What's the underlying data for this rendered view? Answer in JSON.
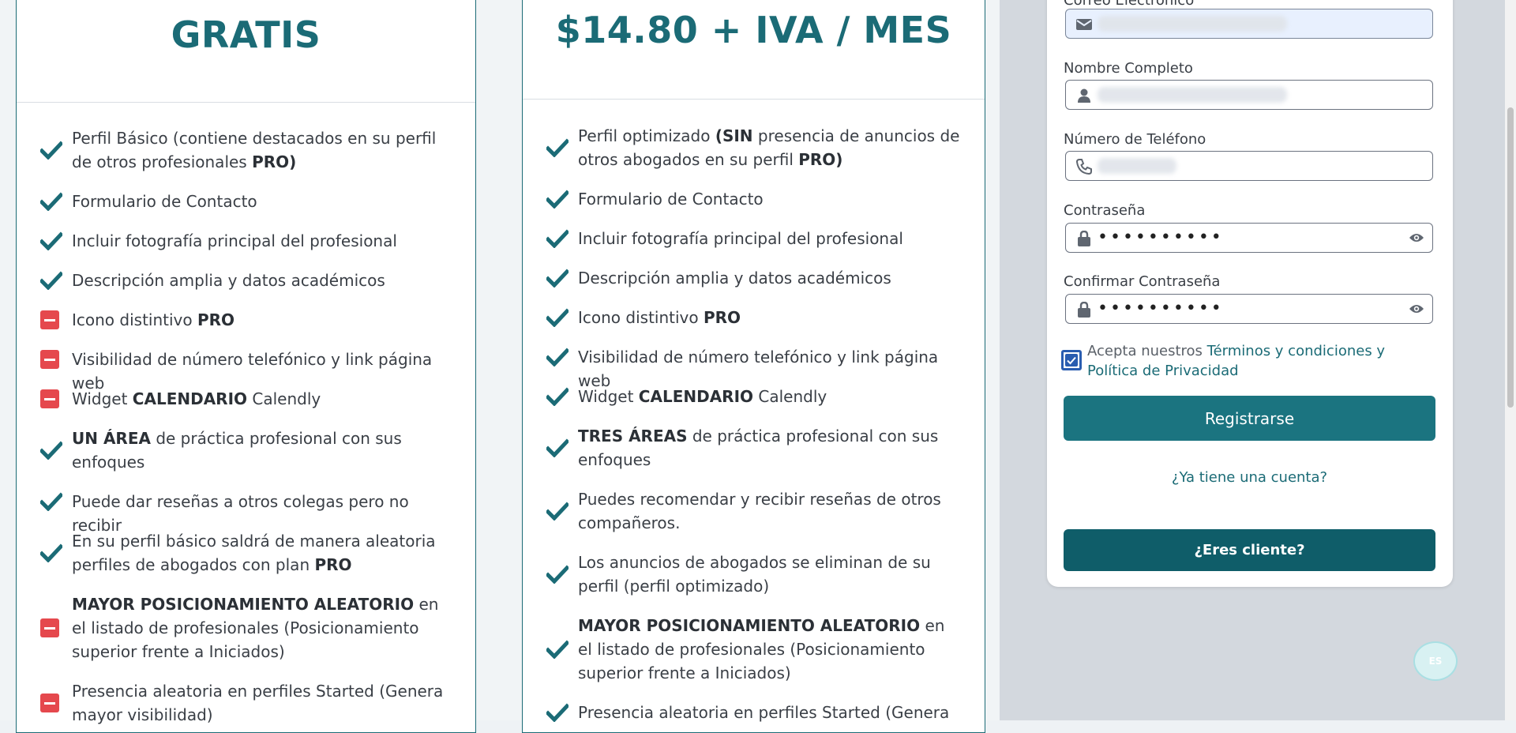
{
  "plans": [
    {
      "price": "GRATIS",
      "features": [
        {
          "icon": "check",
          "parts": [
            {
              "t": "Perfil Básico (contiene destacados en su perfil de otros profesionales "
            },
            {
              "t": "PRO)",
              "b": true
            }
          ]
        },
        {
          "icon": "check",
          "parts": [
            {
              "t": "Formulario de Contacto"
            }
          ]
        },
        {
          "icon": "check",
          "parts": [
            {
              "t": "Incluir fotografía principal del profesional"
            }
          ]
        },
        {
          "icon": "check",
          "parts": [
            {
              "t": "Descripción amplia y datos académicos"
            }
          ]
        },
        {
          "icon": "minus",
          "parts": [
            {
              "t": "Icono distintivo "
            },
            {
              "t": "PRO",
              "b": true
            }
          ]
        },
        {
          "icon": "minus",
          "parts": [
            {
              "t": "Visibilidad de número telefónico y link página web"
            }
          ]
        },
        {
          "icon": "minus",
          "parts": [
            {
              "t": "Widget "
            },
            {
              "t": "CALENDARIO",
              "b": true
            },
            {
              "t": " Calendly"
            }
          ]
        },
        {
          "icon": "check",
          "parts": [
            {
              "t": "UN ÁREA",
              "b": true
            },
            {
              "t": " de práctica profesional con sus enfoques"
            }
          ]
        },
        {
          "icon": "check",
          "parts": [
            {
              "t": "Puede dar reseñas a otros colegas pero no recibir"
            }
          ]
        },
        {
          "icon": "check",
          "parts": [
            {
              "t": "En su perfil básico saldrá de manera aleatoria perfiles de abogados con plan "
            },
            {
              "t": "PRO",
              "b": true
            }
          ]
        },
        {
          "icon": "minus",
          "parts": [
            {
              "t": "MAYOR POSICIONAMIENTO ALEATORIO",
              "b": true
            },
            {
              "t": " en el listado de profesionales (Posicionamiento superior frente a Iniciados)"
            }
          ]
        },
        {
          "icon": "minus",
          "parts": [
            {
              "t": "Presencia aleatoria en perfiles Started (Genera mayor visibilidad)"
            }
          ]
        }
      ]
    },
    {
      "price": "$14.80 + IVA / MES",
      "features": [
        {
          "icon": "check",
          "parts": [
            {
              "t": "Perfil optimizado "
            },
            {
              "t": "(SIN",
              "b": true
            },
            {
              "t": " presencia de anuncios de otros abogados en su perfil "
            },
            {
              "t": "PRO)",
              "b": true
            }
          ]
        },
        {
          "icon": "check",
          "parts": [
            {
              "t": "Formulario de Contacto"
            }
          ]
        },
        {
          "icon": "check",
          "parts": [
            {
              "t": "Incluir fotografía principal del profesional"
            }
          ]
        },
        {
          "icon": "check",
          "parts": [
            {
              "t": "Descripción amplia y datos académicos"
            }
          ]
        },
        {
          "icon": "check",
          "parts": [
            {
              "t": "Icono distintivo "
            },
            {
              "t": "PRO",
              "b": true
            }
          ]
        },
        {
          "icon": "check",
          "parts": [
            {
              "t": "Visibilidad de número telefónico y link página web"
            }
          ]
        },
        {
          "icon": "check",
          "parts": [
            {
              "t": "Widget "
            },
            {
              "t": "CALENDARIO",
              "b": true
            },
            {
              "t": " Calendly"
            }
          ]
        },
        {
          "icon": "check",
          "parts": [
            {
              "t": "TRES ÁREAS",
              "b": true
            },
            {
              "t": " de práctica profesional con sus enfoques"
            }
          ]
        },
        {
          "icon": "check",
          "parts": [
            {
              "t": "Puedes recomendar y recibir reseñas de otros compañeros."
            }
          ]
        },
        {
          "icon": "check",
          "parts": [
            {
              "t": "Los anuncios de abogados se eliminan de su perfil (perfil optimizado)"
            }
          ]
        },
        {
          "icon": "check",
          "parts": [
            {
              "t": "MAYOR POSICIONAMIENTO ALEATORIO",
              "b": true
            },
            {
              "t": " en el listado de profesionales (Posicionamiento superior frente a Iniciados)"
            }
          ]
        },
        {
          "icon": "check",
          "parts": [
            {
              "t": "Presencia aleatoria en perfiles Started (Genera"
            }
          ]
        }
      ]
    }
  ],
  "form": {
    "email_label": "Correo Electronico",
    "fullname_label": "Nombre Completo",
    "phone_label": "Número de Teléfono",
    "password_label": "Contraseña",
    "password_value": "••••••••••",
    "confirm_label": "Confirmar Contraseña",
    "confirm_value": "••••••••••",
    "terms_prefix": "Acepta nuestros ",
    "terms_link": "Términos y condiciones y Política de Privacidad",
    "terms_checked": true,
    "register_button": "Registrarse",
    "login_link": "¿Ya tiene una cuenta?",
    "client_button": "¿Eres cliente?"
  },
  "language_button": "ES",
  "colors": {
    "brand_teal": "#1b6b76",
    "button_teal": "#1b7480",
    "dark_teal": "#0f5d69",
    "minus_red": "#e5484d",
    "check_blue": "#2a5db0"
  },
  "icons": {
    "included": "check-icon",
    "excluded": "minus-icon",
    "email": "envelope-icon",
    "name": "user-icon",
    "phone": "phone-icon",
    "password": "lock-icon",
    "reveal": "eye-icon"
  }
}
